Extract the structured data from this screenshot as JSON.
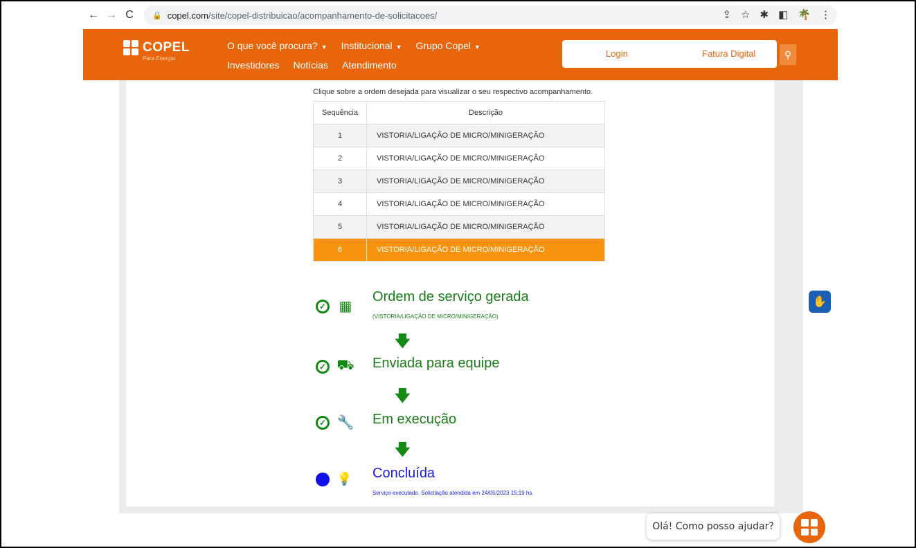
{
  "browser": {
    "url_host": "copel.com",
    "url_path": "/site/copel-distribuicao/acompanhamento-de-solicitacoes/"
  },
  "header": {
    "logo_text": "COPEL",
    "logo_tagline": "Para Energia",
    "menu_row1": [
      {
        "label": "O que você procura?",
        "has_caret": true
      },
      {
        "label": "Institucional",
        "has_caret": true
      },
      {
        "label": "Grupo Copel",
        "has_caret": true
      }
    ],
    "menu_row2": [
      {
        "label": "Investidores"
      },
      {
        "label": "Notícias"
      },
      {
        "label": "Atendimento"
      }
    ],
    "login_label": "Login",
    "fatura_label": "Fatura Digital",
    "brand_color": "#e8650b"
  },
  "main": {
    "intro": "Clique sobre a ordem desejada para visualizar o seu respectivo acompanhamento.",
    "table": {
      "columns": [
        "Sequência",
        "Descrição"
      ],
      "rows": [
        {
          "seq": "1",
          "desc": "VISTORIA/LIGAÇÃO DE MICRO/MINIGERAÇÃO",
          "selected": false
        },
        {
          "seq": "2",
          "desc": "VISTORIA/LIGAÇÃO DE MICRO/MINIGERAÇÃO",
          "selected": false
        },
        {
          "seq": "3",
          "desc": "VISTORIA/LIGAÇÃO DE MICRO/MINIGERAÇÃO",
          "selected": false
        },
        {
          "seq": "4",
          "desc": "VISTORIA/LIGAÇÃO DE MICRO/MINIGERAÇÃO",
          "selected": false
        },
        {
          "seq": "5",
          "desc": "VISTORIA/LIGAÇÃO DE MICRO/MINIGERAÇÃO",
          "selected": false
        },
        {
          "seq": "6",
          "desc": "VISTORIA/LIGAÇÃO DE MICRO/MINIGERAÇÃO",
          "selected": true
        }
      ]
    },
    "timeline": {
      "step1_title": "Ordem de serviço gerada",
      "step1_sub": "(VISTORIA/LIGAÇÃO DE MICRO/MINIGERAÇÃO)",
      "step2_title": "Enviada para equipe",
      "step3_title": "Em execução",
      "step4_title": "Concluída",
      "step4_sub": "Serviço executado. Solicitação atendida em 24/05/2023 15:19 hs.",
      "done_color": "#138a13",
      "current_color": "#1010e8"
    }
  },
  "chat": {
    "bubble_text": "Olá! Como posso ajudar?"
  }
}
